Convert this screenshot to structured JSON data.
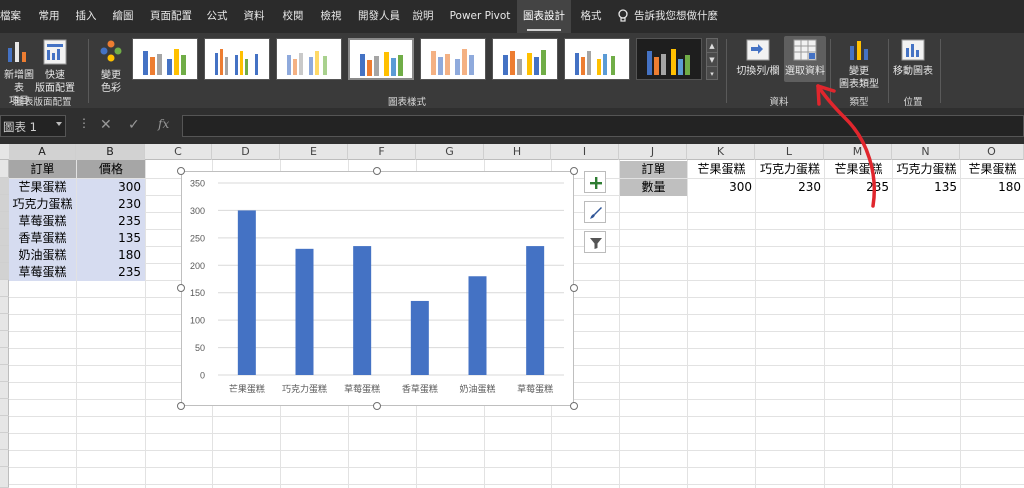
{
  "ribbon_tabs": [
    {
      "label": "檔案"
    },
    {
      "label": "常用"
    },
    {
      "label": "插入"
    },
    {
      "label": "繪圖"
    },
    {
      "label": "頁面配置"
    },
    {
      "label": "公式"
    },
    {
      "label": "資料"
    },
    {
      "label": "校閱"
    },
    {
      "label": "檢視"
    },
    {
      "label": "開發人員"
    },
    {
      "label": "說明"
    },
    {
      "label": "Power Pivot"
    },
    {
      "label": "圖表設計"
    },
    {
      "label": "格式"
    }
  ],
  "active_tab": "圖表設計",
  "tell_me": "告訴我您想做什麼",
  "ribbon": {
    "layout_group": {
      "add_element_line1": "新增圖表",
      "add_element_line2": "項目",
      "quick_layout_line1": "快速",
      "quick_layout_line2": "版面配置",
      "label": "圖表版面配置"
    },
    "styles_group": {
      "change_colors_line1": "變更",
      "change_colors_line2": "色彩",
      "label": "圖表樣式"
    },
    "data_group": {
      "switch_row_col": "切換列/欄",
      "select_data": "選取資料",
      "label": "資料"
    },
    "type_group": {
      "change_type_line1": "變更",
      "change_type_line2": "圖表類型",
      "label": "類型"
    },
    "location_group": {
      "move_chart": "移動圖表",
      "label": "位置"
    }
  },
  "formula_bar": {
    "name_box": "圖表 1",
    "cancel": "✕",
    "enter": "✓",
    "fx": "fx"
  },
  "columns": [
    "A",
    "B",
    "C",
    "D",
    "E",
    "F",
    "G",
    "H",
    "I",
    "J",
    "K",
    "L",
    "M",
    "N",
    "O"
  ],
  "table_vertical": {
    "header_item": "訂單",
    "header_price": "價格",
    "rows": [
      {
        "item": "芒果蛋糕",
        "price": "300"
      },
      {
        "item": "巧克力蛋糕",
        "price": "230"
      },
      {
        "item": "草莓蛋糕",
        "price": "235"
      },
      {
        "item": "香草蛋糕",
        "price": "135"
      },
      {
        "item": "奶油蛋糕",
        "price": "180"
      },
      {
        "item": "草莓蛋糕",
        "price": "235"
      }
    ]
  },
  "table_horizontal": {
    "row1_label": "訂單",
    "row2_label": "數量",
    "items": [
      {
        "name": "芒果蛋糕",
        "qty": "300"
      },
      {
        "name": "巧克力蛋糕",
        "qty": "230"
      },
      {
        "name": "芒果蛋糕",
        "qty": "235"
      },
      {
        "name": "巧克力蛋糕",
        "qty": "135"
      },
      {
        "name": "芒果蛋糕",
        "qty": "180"
      }
    ]
  },
  "colors": {
    "bar": "#4472c4",
    "annotation_arrow": "#e0262d",
    "ribbon_bg": "#3a3a3a",
    "tab_bg": "#2b2b2b"
  },
  "chart_data": {
    "type": "bar",
    "categories": [
      "芒果蛋糕",
      "巧克力蛋糕",
      "草莓蛋糕",
      "香草蛋糕",
      "奶油蛋糕",
      "草莓蛋糕"
    ],
    "values": [
      300,
      230,
      235,
      135,
      180,
      235
    ],
    "yticks": [
      "0",
      "50",
      "100",
      "150",
      "200",
      "250",
      "300",
      "350"
    ],
    "ylim": [
      0,
      350
    ],
    "grid": true,
    "legend": "none",
    "title": "",
    "xlabel": "",
    "ylabel": ""
  }
}
